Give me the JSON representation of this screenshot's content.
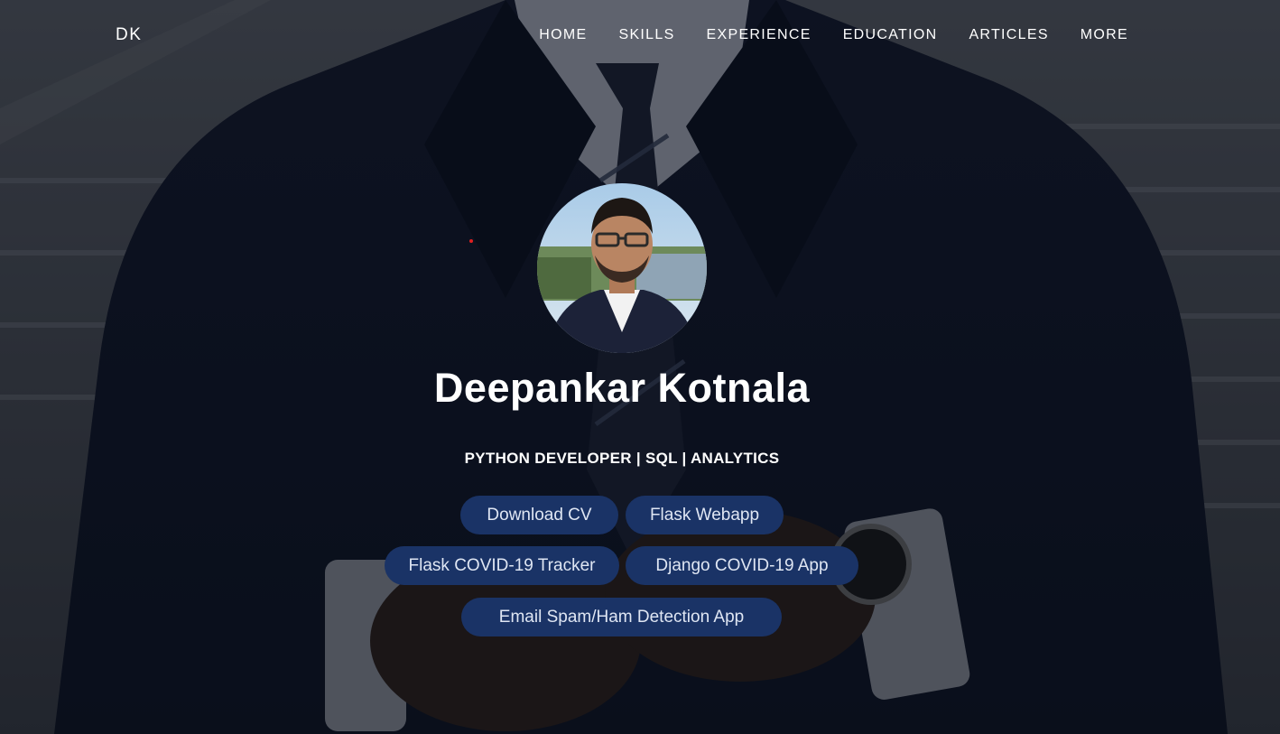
{
  "navbar": {
    "brand": "DK",
    "links": [
      "HOME",
      "SKILLS",
      "EXPERIENCE",
      "EDUCATION",
      "ARTICLES",
      "MORE"
    ]
  },
  "profile": {
    "name": "Deepankar Kotnala",
    "subtitle": "PYTHON DEVELOPER | SQL | ANALYTICS"
  },
  "buttons": {
    "download_cv": "Download CV",
    "flask_webapp": "Flask Webapp",
    "flask_covid": "Flask COVID-19 Tracker",
    "django_covid": "Django COVID-19 App",
    "spam_ham": "Email Spam/Ham Detection App"
  },
  "colors": {
    "button_bg": "#1a3366",
    "button_text": "#dfe6f3",
    "text": "#ffffff"
  }
}
